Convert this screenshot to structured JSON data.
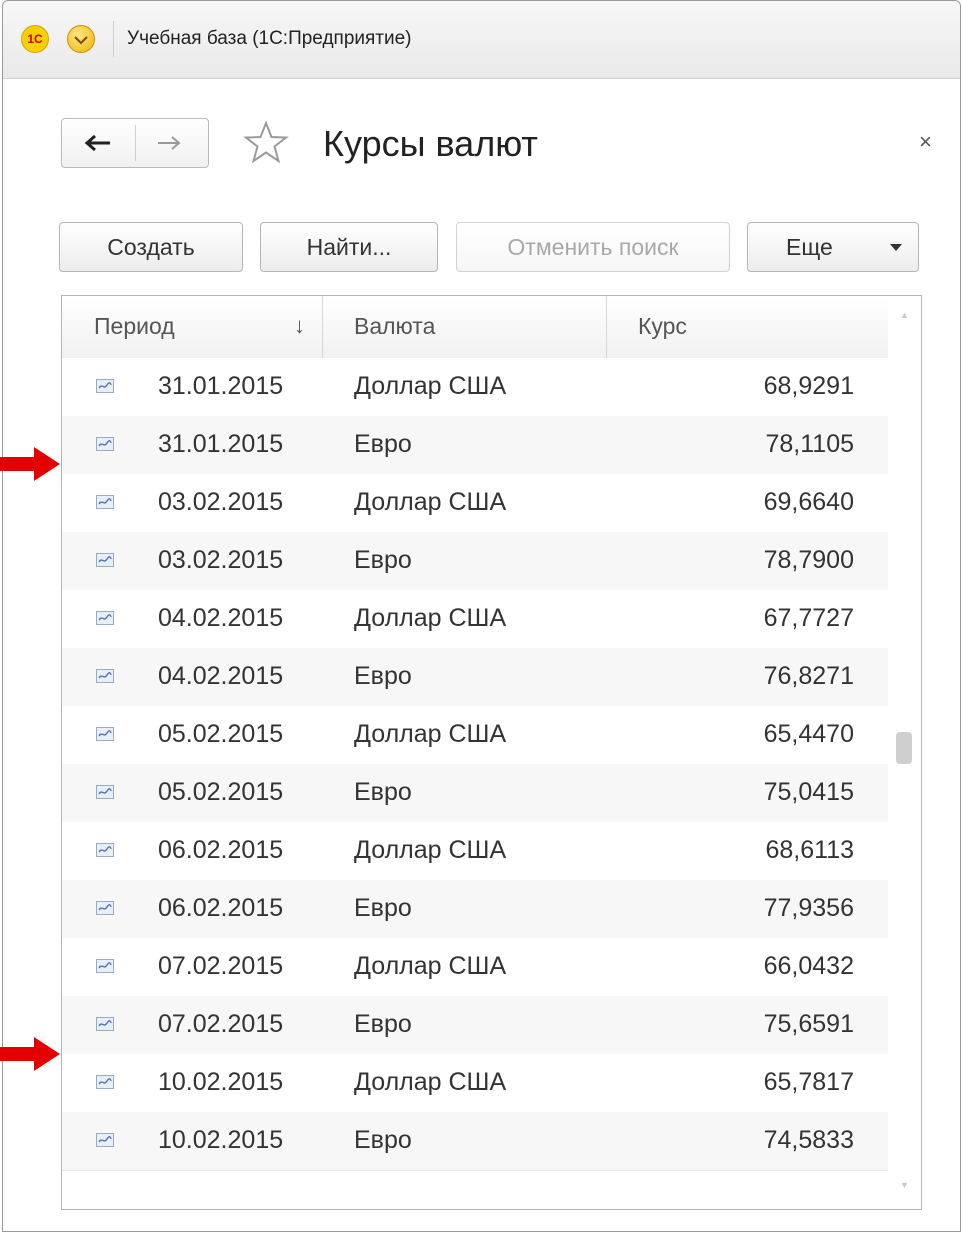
{
  "window": {
    "app_title": "Учебная база (1С:Предприятие)",
    "logo_text": "1С"
  },
  "page": {
    "title": "Курсы валют",
    "close_symbol": "×"
  },
  "toolbar": {
    "create_label": "Создать",
    "find_label": "Найти...",
    "cancel_search_label": "Отменить поиск",
    "more_label": "Еще"
  },
  "grid": {
    "headers": {
      "period": "Период",
      "currency": "Валюта",
      "rate": "Курс"
    },
    "sort_indicator": "↓",
    "rows": [
      {
        "date": "31.01.2015",
        "currency": "Доллар США",
        "rate": "68,9291"
      },
      {
        "date": "31.01.2015",
        "currency": "Евро",
        "rate": "78,1105"
      },
      {
        "date": "03.02.2015",
        "currency": "Доллар США",
        "rate": "69,6640"
      },
      {
        "date": "03.02.2015",
        "currency": "Евро",
        "rate": "78,7900"
      },
      {
        "date": "04.02.2015",
        "currency": "Доллар США",
        "rate": "67,7727"
      },
      {
        "date": "04.02.2015",
        "currency": "Евро",
        "rate": "76,8271"
      },
      {
        "date": "05.02.2015",
        "currency": "Доллар США",
        "rate": "65,4470"
      },
      {
        "date": "05.02.2015",
        "currency": "Евро",
        "rate": "75,0415"
      },
      {
        "date": "06.02.2015",
        "currency": "Доллар США",
        "rate": "68,6113"
      },
      {
        "date": "06.02.2015",
        "currency": "Евро",
        "rate": "77,9356"
      },
      {
        "date": "07.02.2015",
        "currency": "Доллар США",
        "rate": "66,0432"
      },
      {
        "date": "07.02.2015",
        "currency": "Евро",
        "rate": "75,6591"
      },
      {
        "date": "10.02.2015",
        "currency": "Доллар США",
        "rate": "65,7817"
      },
      {
        "date": "10.02.2015",
        "currency": "Евро",
        "rate": "74,5833"
      }
    ]
  },
  "colors": {
    "annotation_arrow": "#e30000"
  },
  "icons": {
    "row_icon": "register-record-icon"
  }
}
